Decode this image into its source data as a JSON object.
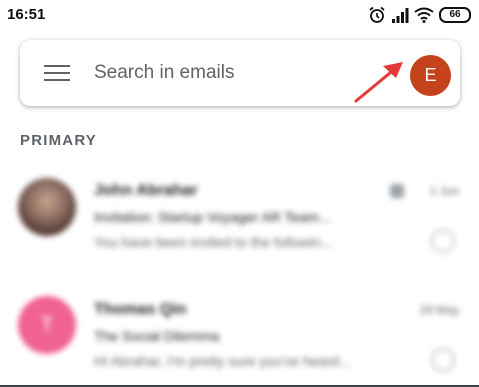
{
  "status_bar": {
    "time": "16:51",
    "battery": "66",
    "icons": [
      "alarm-icon",
      "signal-icon",
      "wifi-icon",
      "battery-icon"
    ]
  },
  "search_bar": {
    "placeholder": "Search in emails",
    "avatar_letter": "E",
    "avatar_color": "#c4431c"
  },
  "section": {
    "label": "PRIMARY"
  },
  "emails": [
    {
      "sender": "John Abrahar",
      "subject": "Invitation: Startup Voyager AR Team...",
      "snippet": "You have been invited to the followin...",
      "time": "1 Jun",
      "avatar_color": "#6d4c41"
    },
    {
      "sender": "Thomas Qin",
      "subject": "The Social Dilemma",
      "snippet": "Hi Abrahar, I'm pretty sure you've heard...",
      "time": "29 May",
      "avatar_letter": "T",
      "avatar_color": "#f06292"
    }
  ],
  "annotation": {
    "arrow_color": "#e53935"
  }
}
